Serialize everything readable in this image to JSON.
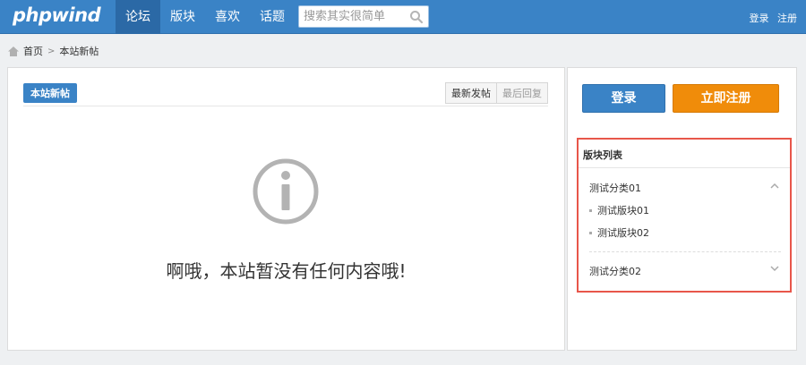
{
  "header": {
    "logo": "phpwind",
    "nav": [
      {
        "label": "论坛",
        "active": true
      },
      {
        "label": "版块",
        "active": false
      },
      {
        "label": "喜欢",
        "active": false
      },
      {
        "label": "话题",
        "active": false
      }
    ],
    "search_placeholder": "搜索其实很简单",
    "login_link": "登录",
    "register_link": "注册",
    "accent_color": "#3a83c6"
  },
  "breadcrumb": {
    "home": "首页",
    "current": "本站新帖"
  },
  "main": {
    "section_tab": "本站新帖",
    "sort_tabs": [
      "最新发帖",
      "最后回复"
    ],
    "empty_message": "啊哦，本站暂没有任何内容哦!"
  },
  "sidebar": {
    "login_button": "登录",
    "register_button": "立即注册",
    "register_color": "#f08c0a",
    "forum_list": {
      "title": "版块列表",
      "categories": [
        {
          "name": "测试分类01",
          "expanded": true,
          "boards": [
            "测试版块01",
            "测试版块02"
          ]
        },
        {
          "name": "测试分类02",
          "expanded": false,
          "boards": []
        }
      ]
    }
  }
}
